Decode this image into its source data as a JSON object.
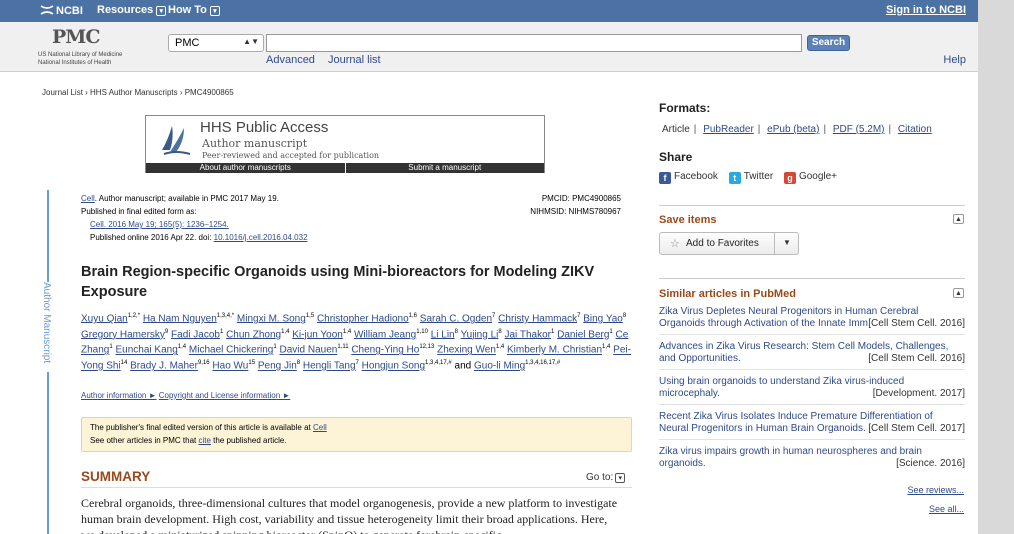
{
  "topbar": {
    "ncbi": "NCBI",
    "resources": "Resources",
    "howto": "How To",
    "signin": "Sign in to NCBI"
  },
  "header": {
    "logo": "PMC",
    "nlm_line1": "US National Library of Medicine",
    "nlm_line2": "National Institutes of Health",
    "db_selected": "PMC",
    "search_value": "",
    "search_button": "Search",
    "advanced": "Advanced",
    "journal_list": "Journal list",
    "help": "Help"
  },
  "breadcrumb": "Journal List › HHS Author Manuscripts › PMC4900865",
  "hhs": {
    "title": "HHS Public Access",
    "subtitle": "Author manuscript",
    "peer": "Peer-reviewed and accepted for publication",
    "about": "About author manuscripts",
    "submit": "Submit a manuscript"
  },
  "side_label": "Author Manuscript",
  "citation": {
    "journal": "Cell",
    "line1_rest": ". Author manuscript; available in PMC 2017 May 19.",
    "line2": "Published in final edited form as:",
    "line3": "Cell. 2016 May 19; 165(5): 1236–1254.",
    "line4_prefix": "Published online 2016 Apr 22. doi: ",
    "doi": "10.1016/j.cell.2016.04.032",
    "pmcid": "PMCID: PMC4900865",
    "nihmsid": "NIHMSID: NIHMS780967"
  },
  "article": {
    "title": "Brain Region-specific Organoids using Mini-bioreactors for Modeling ZIKV Exposure",
    "authors": [
      {
        "name": "Xuyu Qian",
        "sup": "1,2,*"
      },
      {
        "name": "Ha Nam Nguyen",
        "sup": "1,3,4,*"
      },
      {
        "name": "Mingxi M. Song",
        "sup": "1,5"
      },
      {
        "name": "Christopher Hadiono",
        "sup": "1,6"
      },
      {
        "name": "Sarah C. Ogden",
        "sup": "7"
      },
      {
        "name": "Christy Hammack",
        "sup": "7"
      },
      {
        "name": "Bing Yao",
        "sup": "8"
      },
      {
        "name": "Gregory Hamersky",
        "sup": "9"
      },
      {
        "name": "Fadi Jacob",
        "sup": "1"
      },
      {
        "name": "Chun Zhong",
        "sup": "1,4"
      },
      {
        "name": "Ki-jun Yoon",
        "sup": "1,4"
      },
      {
        "name": "William Jeang",
        "sup": "1,10"
      },
      {
        "name": "Li Lin",
        "sup": "8"
      },
      {
        "name": "Yujing Li",
        "sup": "8"
      },
      {
        "name": "Jai Thakor",
        "sup": "1"
      },
      {
        "name": "Daniel Berg",
        "sup": "1"
      },
      {
        "name": "Ce Zhang",
        "sup": "1"
      },
      {
        "name": "Eunchai Kang",
        "sup": "1,4"
      },
      {
        "name": "Michael Chickering",
        "sup": "1"
      },
      {
        "name": "David Nauen",
        "sup": "1,11"
      },
      {
        "name": "Cheng-Ying Ho",
        "sup": "12,13"
      },
      {
        "name": "Zhexing Wen",
        "sup": "1,4"
      },
      {
        "name": "Kimberly M. Christian",
        "sup": "1,4"
      },
      {
        "name": "Pei-Yong Shi",
        "sup": "14"
      },
      {
        "name": "Brady J. Maher",
        "sup": "9,16"
      },
      {
        "name": "Hao Wu",
        "sup": "15"
      },
      {
        "name": "Peng Jin",
        "sup": "8"
      },
      {
        "name": "Hengli Tang",
        "sup": "7"
      },
      {
        "name": "Hongjun Song",
        "sup": "1,3,4,17,#"
      },
      {
        "name": "Guo-li Ming",
        "sup": "1,3,4,16,17,#"
      }
    ],
    "and_word": "and",
    "author_info": "Author information ►",
    "copyright": "Copyright and License information ►"
  },
  "notice": {
    "line1_prefix": "The publisher's final edited version of this article is available at ",
    "line1_link": "Cell",
    "line2_prefix": "See other articles in PMC that ",
    "line2_link": "cite",
    "line2_suffix": " the published article."
  },
  "summary": {
    "heading": "SUMMARY",
    "goto": "Go to:",
    "text": "Cerebral organoids, three-dimensional cultures that model organogenesis, provide a new platform to investigate human brain development. High cost, variability and tissue heterogeneity limit their broad applications. Here, we developed a miniaturized spinning bioreactor (SpinΩ) to generate forebrain-specific"
  },
  "formats": {
    "heading": "Formats:",
    "article": "Article",
    "pubreader": "PubReader",
    "epub": "ePub (beta)",
    "pdf": "PDF (5.2M)",
    "citation": "Citation"
  },
  "share": {
    "heading": "Share",
    "facebook": "Facebook",
    "twitter": "Twitter",
    "google": "Google+"
  },
  "save_items": {
    "heading": "Save items",
    "add_favorites": "Add to Favorites"
  },
  "similar": {
    "heading": "Similar articles in PubMed",
    "items": [
      {
        "line1": "Zika Virus Depletes Neural Progenitors in Human Cerebral",
        "line2": "Organoids through Activation of the Innate Immune Receptor TLR3.",
        "journal": "[Cell Stem Cell. 2016]"
      },
      {
        "line1": "Advances in Zika Virus Research: Stem Cell Models, Challenges,",
        "line2": "and Opportunities.",
        "journal": "[Cell Stem Cell. 2016]"
      },
      {
        "line1": "Using brain organoids to understand Zika virus-induced",
        "line2": "microcephaly.",
        "journal": "[Development. 2017]"
      },
      {
        "line1": "Recent Zika Virus Isolates Induce Premature Differentiation of",
        "line2": "Neural Progenitors in Human Brain Organoids.",
        "journal": "[Cell Stem Cell. 2017]"
      },
      {
        "line1": "Zika virus impairs growth in human neurospheres and brain",
        "line2": "organoids.",
        "journal": "[Science. 2016]"
      }
    ],
    "see_reviews": "See reviews...",
    "see_all": "See all..."
  },
  "colors": {
    "topbar": "#4c72a4",
    "link": "#2f4a8a",
    "accent_heading": "#9a4a1a",
    "side_accent": "#6a9bd0",
    "notice_bg": "#fdf3d7"
  }
}
